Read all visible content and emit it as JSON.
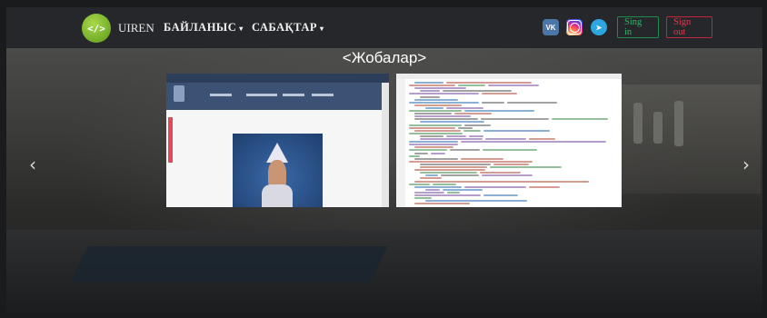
{
  "navbar": {
    "logo_glyph": "</>",
    "brand": "UIREN",
    "menu": [
      {
        "label": "БАЙЛАНЫС"
      },
      {
        "label": "САБАҚТАР"
      }
    ],
    "caret": "▾",
    "social": [
      {
        "name": "vk-icon",
        "glyph": "VK"
      },
      {
        "name": "instagram-icon",
        "glyph": ""
      },
      {
        "name": "telegram-icon",
        "glyph": "➤"
      }
    ],
    "sign_in": "Sing in",
    "sign_out": "Sign out"
  },
  "hero": {
    "slide_title": "<Жобалар>",
    "prev_arrow": "‹",
    "next_arrow": "›"
  },
  "colors": {
    "navbar_bg": "#26272b",
    "sign_in": "#2bb566",
    "sign_out": "#e03b50"
  }
}
